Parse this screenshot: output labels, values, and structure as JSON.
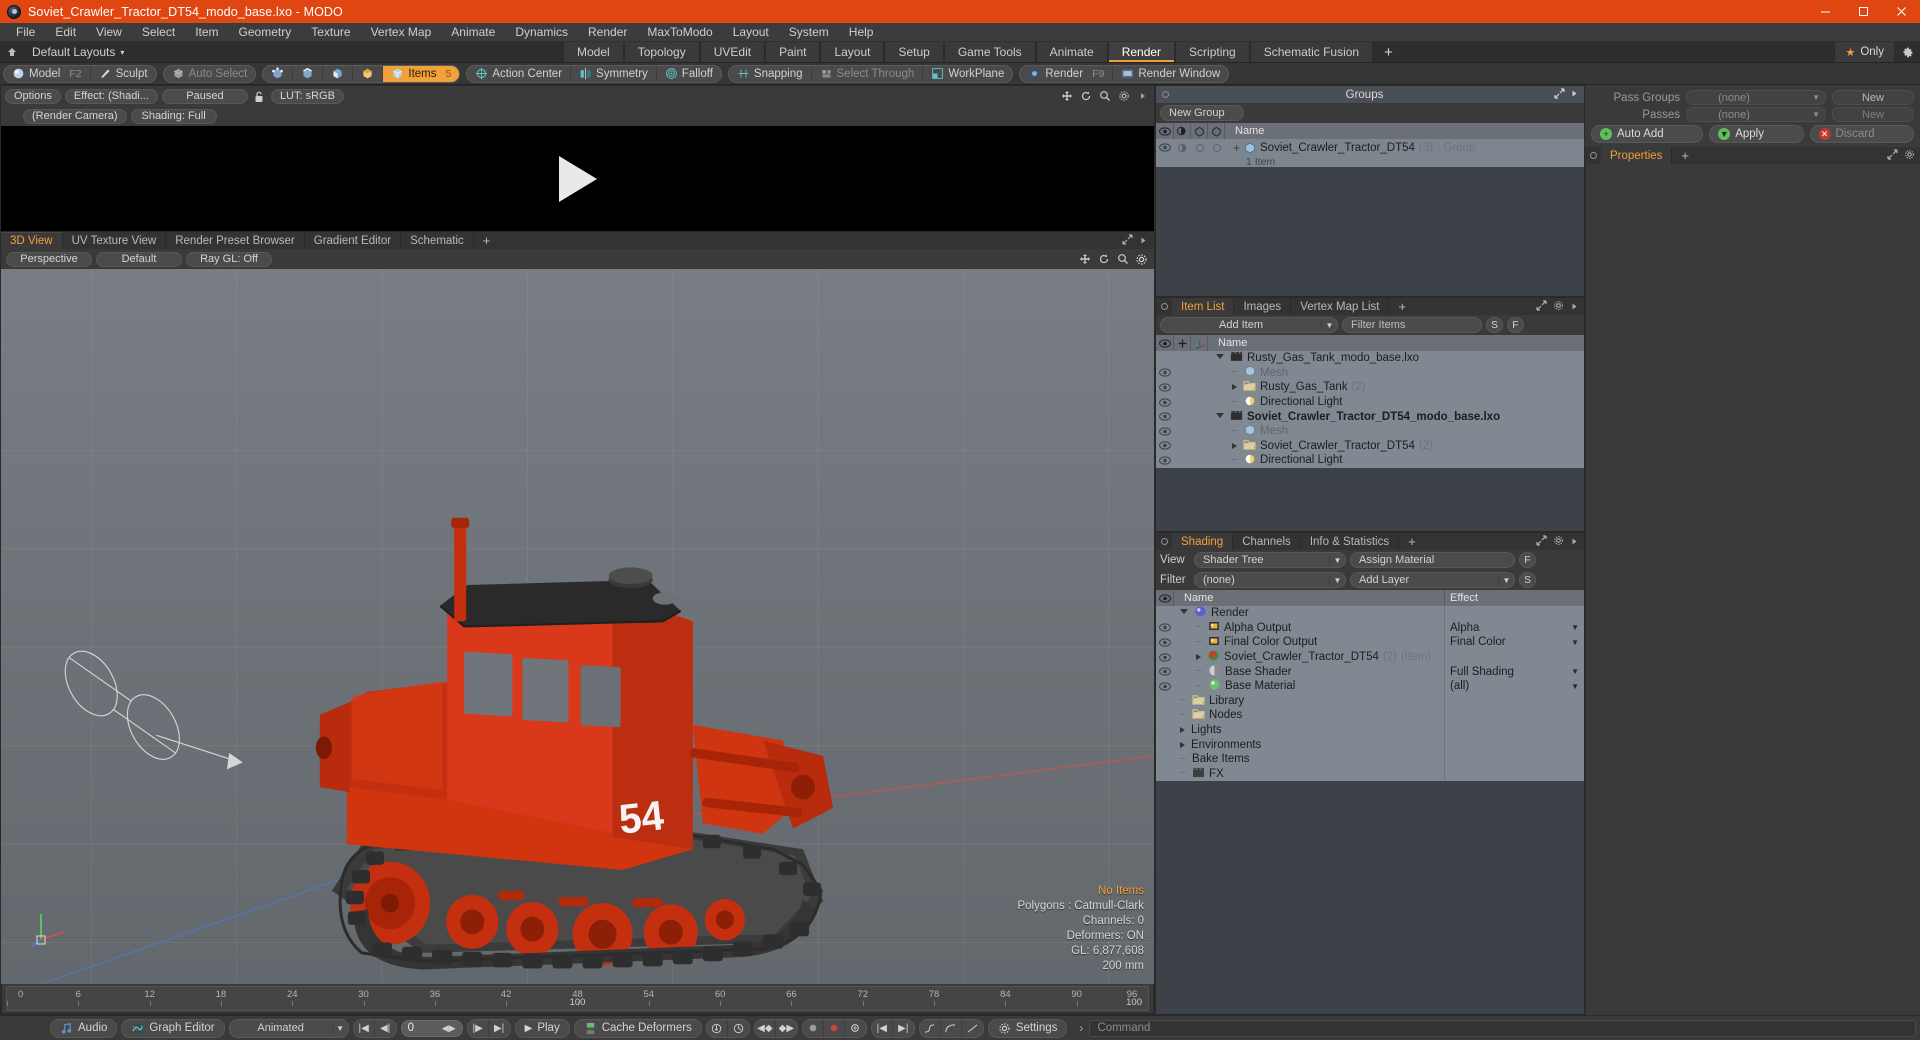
{
  "window": {
    "title": "Soviet_Crawler_Tractor_DT54_modo_base.lxo - MODO",
    "minimize": "—",
    "maximize": "❐",
    "close": "✕"
  },
  "menubar": {
    "items": [
      "File",
      "Edit",
      "View",
      "Select",
      "Item",
      "Geometry",
      "Texture",
      "Vertex Map",
      "Animate",
      "Dynamics",
      "Render",
      "MaxToModo",
      "Layout",
      "System",
      "Help"
    ]
  },
  "layoutbar": {
    "home_icon": "home-icon",
    "default_layouts": "Default Layouts",
    "caret": "▾",
    "tabs": [
      {
        "label": "Model",
        "active": false
      },
      {
        "label": "Topology",
        "active": false
      },
      {
        "label": "UVEdit",
        "active": false
      },
      {
        "label": "Paint",
        "active": false
      },
      {
        "label": "Layout",
        "active": false
      },
      {
        "label": "Setup",
        "active": false
      },
      {
        "label": "Game Tools",
        "active": false
      },
      {
        "label": "Animate",
        "active": false
      },
      {
        "label": "Render",
        "active": true
      },
      {
        "label": "Scripting",
        "active": false
      },
      {
        "label": "Schematic Fusion",
        "active": false
      }
    ],
    "add_tab": "+",
    "only_badge": "Only",
    "star": "★"
  },
  "modebar": {
    "groups": [
      {
        "buttons": [
          {
            "label": "Model",
            "key": "F2",
            "icon": "sphere-icon",
            "state": "normal"
          },
          {
            "label": "Sculpt",
            "key": "",
            "icon": "brush-icon",
            "state": "normal"
          }
        ]
      },
      {
        "buttons": [
          {
            "label": "Auto Select",
            "key": "",
            "icon": "cube-grey-icon",
            "state": "dim"
          }
        ]
      },
      {
        "buttons": [
          {
            "label": "",
            "key": "",
            "icon": "vertices-icon",
            "state": "normal"
          },
          {
            "label": "",
            "key": "",
            "icon": "edges-icon",
            "state": "normal"
          },
          {
            "label": "",
            "key": "",
            "icon": "polygons-icon",
            "state": "normal"
          },
          {
            "label": "",
            "key": "",
            "icon": "materials-icon",
            "state": "normal"
          },
          {
            "label": "Items",
            "key": "5",
            "icon": "items-icon",
            "state": "selected"
          }
        ]
      },
      {
        "buttons": [
          {
            "label": "Action Center",
            "key": "",
            "icon": "action-center-icon",
            "state": "normal"
          },
          {
            "label": "Symmetry",
            "key": "",
            "icon": "symmetry-icon",
            "state": "normal"
          },
          {
            "label": "Falloff",
            "key": "",
            "icon": "falloff-icon",
            "state": "normal"
          }
        ]
      },
      {
        "buttons": [
          {
            "label": "Snapping",
            "key": "",
            "icon": "snapping-icon",
            "state": "normal"
          },
          {
            "label": "Select Through",
            "key": "",
            "icon": "select-through-icon",
            "state": "dim"
          },
          {
            "label": "WorkPlane",
            "key": "",
            "icon": "workplane-icon",
            "state": "normal"
          }
        ]
      },
      {
        "buttons": [
          {
            "label": "Render",
            "key": "F9",
            "icon": "render-icon",
            "state": "normal"
          },
          {
            "label": "Render Window",
            "key": "",
            "icon": "render-window-icon",
            "state": "normal"
          }
        ]
      }
    ]
  },
  "render_preview": {
    "toolbar": [
      "Options",
      "Effect: (Shadi...",
      "Paused"
    ],
    "lock_icon": "unlock-icon",
    "lut": "LUT: sRGB",
    "row2": [
      "(Render Camera)",
      "Shading: Full"
    ],
    "icons": [
      "move-icon",
      "rotate-icon",
      "zoom-icon",
      "gear-icon",
      "arrow-icon"
    ],
    "play_overlay": "play-triangle-icon"
  },
  "viewport": {
    "tabs": [
      {
        "label": "3D View",
        "active": true
      },
      {
        "label": "UV Texture View",
        "active": false
      },
      {
        "label": "Render Preset Browser",
        "active": false
      },
      {
        "label": "Gradient Editor",
        "active": false
      },
      {
        "label": "Schematic",
        "active": false
      }
    ],
    "add_tab": "+",
    "tools": [
      "Perspective",
      "Default",
      "Ray GL: Off"
    ],
    "right_icons": [
      "move-icon",
      "rotate-icon",
      "zoom-icon",
      "gear-icon"
    ],
    "stats": {
      "no_items": "No Items",
      "polygons": "Polygons : Catmull-Clark",
      "channels": "Channels: 0",
      "deformers": "Deformers: ON",
      "gl": "GL: 6,877,608",
      "scale": "200 mm"
    },
    "model_colors": {
      "body": "#d9361b",
      "body_dark": "#a52510",
      "track": "#3c3c3c",
      "roof": "#2e2e2e",
      "number": "54",
      "glass": "#6d7278",
      "background": "#6f7479",
      "axis_red": "#c2564a",
      "axis_blue": "#4a7bc2"
    }
  },
  "timeline": {
    "ticks": [
      "0",
      "6",
      "12",
      "18",
      "24",
      "30",
      "36",
      "42",
      "48",
      "54",
      "60",
      "66",
      "72",
      "78",
      "84",
      "90",
      "96"
    ],
    "center_label": "100",
    "end_label": "100"
  },
  "groups_panel": {
    "title": "Groups",
    "new_group_button": "New Group",
    "columns": [
      "eye-icon",
      "shade-icon",
      "render-icon",
      "select-icon",
      "Name"
    ],
    "rows": [
      {
        "name": "Soviet_Crawler_Tractor_DT54",
        "count": "(3)",
        "suffix": ": Group",
        "sub": "1 Item",
        "icon": "group-icon"
      }
    ]
  },
  "pass_panel": {
    "pass_groups_label": "Pass Groups",
    "pass_groups_value": "(none)",
    "passes_label": "Passes",
    "passes_value": "(none)",
    "new_button_1": "New",
    "new_button_2": "New",
    "auto_add": "Auto Add",
    "apply": "Apply",
    "discard": "Discard",
    "properties_tab": "Properties",
    "add_tab": "+"
  },
  "item_list": {
    "tabs": [
      {
        "label": "Item List",
        "active": true
      },
      {
        "label": "Images",
        "active": false
      },
      {
        "label": "Vertex Map List",
        "active": false
      }
    ],
    "add_tab": "+",
    "add_item": "Add Item",
    "filter_placeholder": "Filter Items",
    "btn_s": "S",
    "btn_f": "F",
    "col_name": "Name",
    "rows": [
      {
        "indent": 0,
        "name": "Rusty_Gas_Tank_modo_base.lxo",
        "count": "",
        "icon": "scene-icon",
        "expander": "down",
        "eye": false,
        "bold": false,
        "grey": false
      },
      {
        "indent": 1,
        "name": "Mesh",
        "count": "",
        "icon": "mesh-icon",
        "expander": "none",
        "eye": true,
        "bold": false,
        "grey": true
      },
      {
        "indent": 1,
        "name": "Rusty_Gas_Tank",
        "count": "(2)",
        "icon": "folder-icon",
        "expander": "right",
        "eye": true,
        "bold": false,
        "grey": false
      },
      {
        "indent": 1,
        "name": "Directional Light",
        "count": "",
        "icon": "light-icon",
        "expander": "none",
        "eye": true,
        "bold": false,
        "grey": false
      },
      {
        "indent": 0,
        "name": "Soviet_Crawler_Tractor_DT54_modo_base.lxo",
        "count": "",
        "icon": "scene-icon",
        "expander": "down",
        "eye": true,
        "bold": true,
        "grey": false
      },
      {
        "indent": 1,
        "name": "Mesh",
        "count": "",
        "icon": "mesh-icon",
        "expander": "none",
        "eye": true,
        "bold": false,
        "grey": true
      },
      {
        "indent": 1,
        "name": "Soviet_Crawler_Tractor_DT54",
        "count": "(2)",
        "icon": "folder-icon",
        "expander": "right",
        "eye": true,
        "bold": false,
        "grey": false
      },
      {
        "indent": 1,
        "name": "Directional Light",
        "count": "",
        "icon": "light-icon",
        "expander": "none",
        "eye": true,
        "bold": false,
        "grey": false
      }
    ]
  },
  "shading": {
    "tabs": [
      {
        "label": "Shading",
        "active": true
      },
      {
        "label": "Channels",
        "active": false
      },
      {
        "label": "Info & Statistics",
        "active": false
      }
    ],
    "add_tab": "+",
    "view_label": "View",
    "view_value": "Shader Tree",
    "assign_material": "Assign Material",
    "btn_f": "F",
    "filter_label": "Filter",
    "filter_value": "(none)",
    "add_layer": "Add Layer",
    "btn_s": "S",
    "col_name": "Name",
    "col_effect": "Effect",
    "rows": [
      {
        "indent": 0,
        "name": "Render",
        "count": "",
        "suffix": "",
        "effect": "",
        "icon": "render-globe-icon",
        "expander": "down",
        "eye": false
      },
      {
        "indent": 1,
        "name": "Alpha Output",
        "count": "",
        "suffix": "",
        "effect": "Alpha",
        "icon": "output-icon",
        "expander": "none",
        "eye": true
      },
      {
        "indent": 1,
        "name": "Final Color Output",
        "count": "",
        "suffix": "",
        "effect": "Final Color",
        "icon": "output-icon",
        "expander": "none",
        "eye": true
      },
      {
        "indent": 1,
        "name": "Soviet_Crawler_Tractor_DT54",
        "count": "(2)",
        "suffix": "(Item)",
        "effect": "",
        "icon": "material-red-icon",
        "expander": "right",
        "eye": true
      },
      {
        "indent": 1,
        "name": "Base Shader",
        "count": "",
        "suffix": "",
        "effect": "Full Shading",
        "icon": "shader-icon",
        "expander": "none",
        "eye": true
      },
      {
        "indent": 1,
        "name": "Base Material",
        "count": "",
        "suffix": "",
        "effect": "(all)",
        "icon": "material-green-icon",
        "expander": "none",
        "eye": true
      },
      {
        "indent": 0,
        "name": "Library",
        "count": "",
        "suffix": "",
        "effect": "",
        "icon": "folder-icon",
        "expander": "none",
        "eye": false
      },
      {
        "indent": 0,
        "name": "Nodes",
        "count": "",
        "suffix": "",
        "effect": "",
        "icon": "folder-icon",
        "expander": "none",
        "eye": false
      },
      {
        "indent": 0,
        "name": "Lights",
        "count": "",
        "suffix": "",
        "effect": "",
        "icon": "none",
        "expander": "right",
        "eye": false
      },
      {
        "indent": 0,
        "name": "Environments",
        "count": "",
        "suffix": "",
        "effect": "",
        "icon": "none",
        "expander": "right",
        "eye": false
      },
      {
        "indent": 0,
        "name": "Bake Items",
        "count": "",
        "suffix": "",
        "effect": "",
        "icon": "none",
        "expander": "none",
        "eye": false
      },
      {
        "indent": 0,
        "name": "FX",
        "count": "",
        "suffix": "",
        "effect": "",
        "icon": "fx-icon",
        "expander": "none",
        "eye": false
      }
    ]
  },
  "bottombar": {
    "audio": "Audio",
    "graph_editor": "Graph Editor",
    "animated": "Animated",
    "frame_value": "0",
    "play": "Play",
    "cache_deformers": "Cache Deformers",
    "settings": "Settings",
    "command_placeholder": "Command",
    "command_arrow": "›"
  }
}
